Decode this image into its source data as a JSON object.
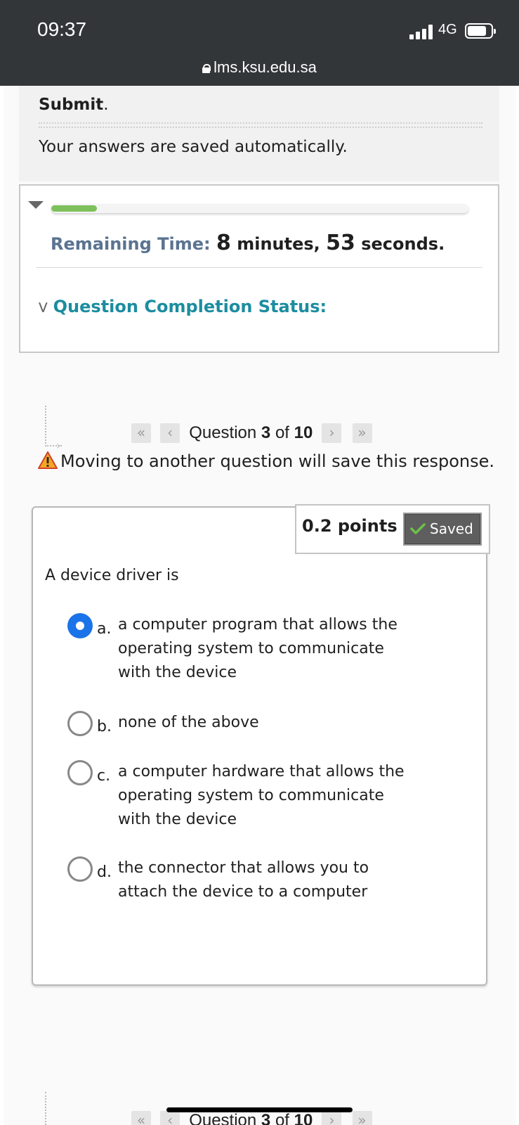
{
  "status_bar": {
    "time": "09:37",
    "network": "4G",
    "icons": [
      "signal-icon",
      "battery-icon"
    ]
  },
  "browser": {
    "url": "lms.ksu.edu.sa",
    "icons": [
      "lock-icon"
    ]
  },
  "instructions": {
    "submit_bold": "Submit",
    "submit_trailing": ".",
    "saved_text": "Your answers are saved automatically."
  },
  "timer": {
    "remaining_label": "Remaining Time:",
    "minutes_value": "8",
    "minutes_label": "minutes,",
    "seconds_value": "53",
    "seconds_label": "seconds.",
    "elapsed_fraction": 0.11,
    "progress_color": "#7dc05c",
    "completion_label": "Question Completion Status:",
    "icons": [
      "collapse-triangle-icon",
      "double-chevron-down-icon"
    ]
  },
  "question_nav": {
    "prefix": "Question",
    "current": "3",
    "of": "of",
    "total": "10",
    "first_glyph": "«",
    "prev_glyph": "‹",
    "next_glyph": "›",
    "last_glyph": "»",
    "warning": "Moving to another question will save this response.",
    "icons": [
      "warning-icon"
    ]
  },
  "question": {
    "points": "0.2 points",
    "saved_label": "Saved",
    "text": "A device driver is",
    "selected_option": "a",
    "accent_color": "#1a73e8",
    "options": [
      {
        "letter": "a.",
        "text": "a computer program that allows the operating system to communicate with the device"
      },
      {
        "letter": "b.",
        "text": "none of the above"
      },
      {
        "letter": "c.",
        "text": "a computer hardware that allows the operating system to communicate with the device"
      },
      {
        "letter": "d.",
        "text": "the connector that allows you to attach the device to a computer"
      }
    ]
  }
}
